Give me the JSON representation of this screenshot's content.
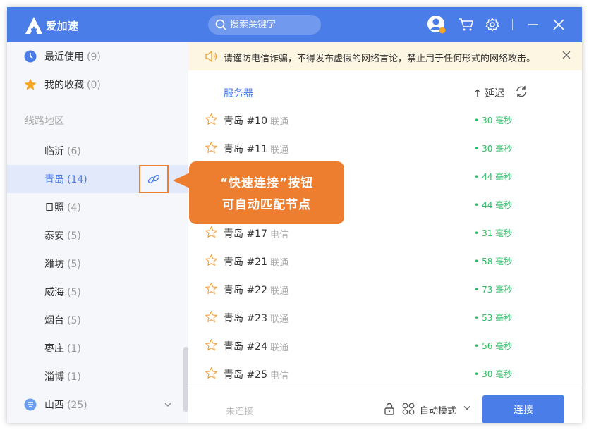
{
  "app": {
    "name": "爱加速"
  },
  "search": {
    "placeholder": "搜索关键字"
  },
  "sidebar": {
    "recent": {
      "label": "最近使用",
      "count": "(9)"
    },
    "favorites": {
      "label": "我的收藏",
      "count": "(0)"
    },
    "section_title": "线路地区",
    "regions": [
      {
        "label": "临沂",
        "count": "(6)"
      },
      {
        "label": "青岛",
        "count": "(14)"
      },
      {
        "label": "日照",
        "count": "(4)"
      },
      {
        "label": "泰安",
        "count": "(5)"
      },
      {
        "label": "潍坊",
        "count": "(5)"
      },
      {
        "label": "威海",
        "count": "(5)"
      },
      {
        "label": "烟台",
        "count": "(5)"
      },
      {
        "label": "枣庄",
        "count": "(1)"
      },
      {
        "label": "淄博",
        "count": "(1)"
      }
    ],
    "province": {
      "label": "山西",
      "count": "(25)"
    }
  },
  "notice": {
    "text": "请谨防电信诈骗，不得发布虚假的网络言论，禁止用于任何形式的网络攻击。"
  },
  "table": {
    "header_server": "服务器",
    "header_delay": "↑ 延迟",
    "rows": [
      {
        "name": "青岛 #10",
        "isp": "联通",
        "latency": "30 毫秒"
      },
      {
        "name": "青岛 #11",
        "isp": "联通",
        "latency": "30 毫秒"
      },
      {
        "name": "",
        "isp": "",
        "latency": "44 毫秒"
      },
      {
        "name": "",
        "isp": "",
        "latency": "44 毫秒"
      },
      {
        "name": "青岛 #17",
        "isp": "电信",
        "latency": "31 毫秒"
      },
      {
        "name": "青岛 #21",
        "isp": "联通",
        "latency": "58 毫秒"
      },
      {
        "name": "青岛 #22",
        "isp": "联通",
        "latency": "73 毫秒"
      },
      {
        "name": "青岛 #23",
        "isp": "联通",
        "latency": "53 毫秒"
      },
      {
        "name": "青岛 #24",
        "isp": "联通",
        "latency": "56 毫秒"
      },
      {
        "name": "青岛 #25",
        "isp": "电信",
        "latency": "30 毫秒"
      }
    ]
  },
  "footer": {
    "status": "未连接",
    "mode": "自动模式",
    "connect": "连接"
  },
  "callout": {
    "line1": "“快速连接”按钮",
    "line2": "可自动匹配节点"
  },
  "colors": {
    "primary": "#4a7de8",
    "accent": "#ee7e2f",
    "latency": "#2dbb66",
    "notice_bg": "#fdf6e3"
  }
}
